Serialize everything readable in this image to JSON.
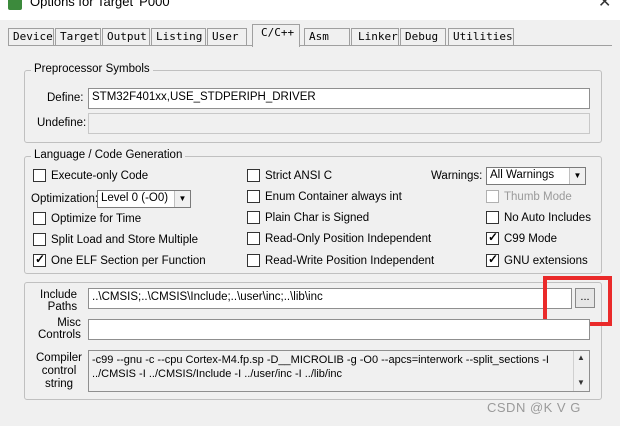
{
  "window": {
    "title": "Options for Target 'P000'",
    "close": "✕"
  },
  "tabs": [
    "Device",
    "Target",
    "Output",
    "Listing",
    "User",
    "C/C++",
    "Asm",
    "Linker",
    "Debug",
    "Utilities"
  ],
  "active_tab": "C/C++",
  "preprocessor": {
    "title": "Preprocessor Symbols",
    "define_label": "Define:",
    "define_value": "STM32F401xx,USE_STDPERIPH_DRIVER",
    "undefine_label": "Undefine:",
    "undefine_value": ""
  },
  "language": {
    "title": "Language / Code Generation",
    "execute_only": {
      "label": "Execute-only Code",
      "checked": false
    },
    "optimization_label": "Optimization:",
    "optimization_value": "Level 0 (-O0)",
    "optimize_time": {
      "label": "Optimize for Time",
      "checked": false
    },
    "split_load": {
      "label": "Split Load and Store Multiple",
      "checked": false
    },
    "one_elf": {
      "label": "One ELF Section per Function",
      "checked": true
    },
    "strict_ansi": {
      "label": "Strict ANSI C",
      "checked": false
    },
    "enum_container": {
      "label": "Enum Container always int",
      "checked": false
    },
    "plain_char": {
      "label": "Plain Char is Signed",
      "checked": false
    },
    "ro_pos": {
      "label": "Read-Only Position Independent",
      "checked": false
    },
    "rw_pos": {
      "label": "Read-Write Position Independent",
      "checked": false
    },
    "warnings_label": "Warnings:",
    "warnings_value": "All Warnings",
    "thumb_mode": {
      "label": "Thumb Mode",
      "checked": false,
      "disabled": true
    },
    "no_auto": {
      "label": "No Auto Includes",
      "checked": false
    },
    "c99": {
      "label": "C99 Mode",
      "checked": true
    },
    "gnu_ext": {
      "label": "GNU extensions",
      "checked": true
    }
  },
  "paths": {
    "include_label_1": "Include",
    "include_label_2": "Paths",
    "include_value": "..\\CMSIS;..\\CMSIS\\Include;..\\user\\inc;..\\lib\\inc",
    "browse_label": "...",
    "misc_label_1": "Misc",
    "misc_label_2": "Controls",
    "misc_value": "",
    "compiler_label_1": "Compiler",
    "compiler_label_2": "control",
    "compiler_label_3": "string",
    "compiler_line_1": "-c99 --gnu -c --cpu Cortex-M4.fp.sp -D__MICROLIB -g -O0 --apcs=interwork --split_sections -I",
    "compiler_line_2": "../CMSIS -I ../CMSIS/Include -I ../user/inc -I ../lib/inc"
  },
  "watermark": "CSDN @K V G",
  "colors": {
    "highlight": "#ea2a2a",
    "app_icon": "#3c8a3c"
  }
}
